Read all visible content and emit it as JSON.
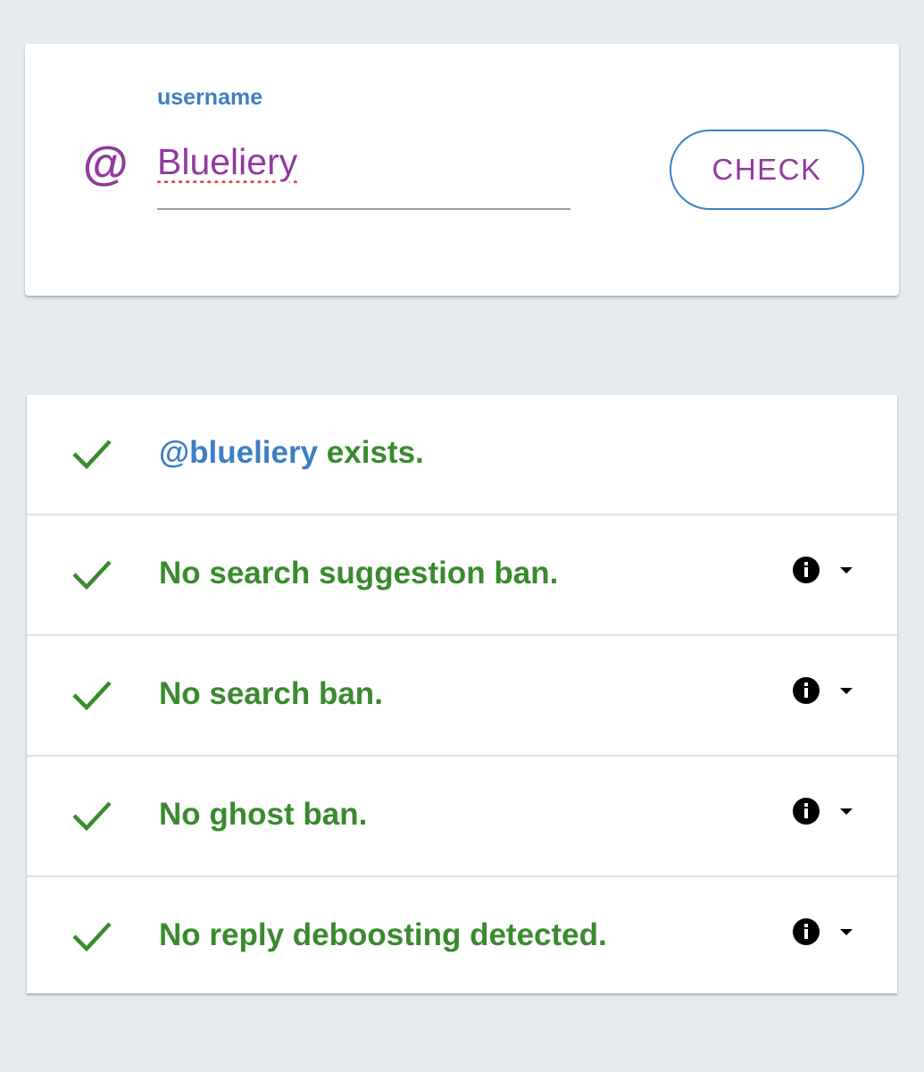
{
  "input_card": {
    "at_symbol": "@",
    "label": "username",
    "value": "Blueliery",
    "button_label": "CHECK"
  },
  "results": [
    {
      "icon": "checkmark-icon",
      "handle": "@blueliery",
      "text": " exists.",
      "has_info": false
    },
    {
      "icon": "checkmark-icon",
      "text": "No search suggestion ban.",
      "has_info": true
    },
    {
      "icon": "checkmark-icon",
      "text": "No search ban.",
      "has_info": true
    },
    {
      "icon": "checkmark-icon",
      "text": "No ghost ban.",
      "has_info": true
    },
    {
      "icon": "checkmark-icon",
      "text": "No reply deboosting detected.",
      "has_info": true
    }
  ],
  "colors": {
    "background": "#e6ebf0",
    "accent_purple": "#93399f",
    "accent_blue": "#3d7fc3",
    "success_green": "#3a8a2e",
    "spellcheck_red": "#e44b4b"
  }
}
